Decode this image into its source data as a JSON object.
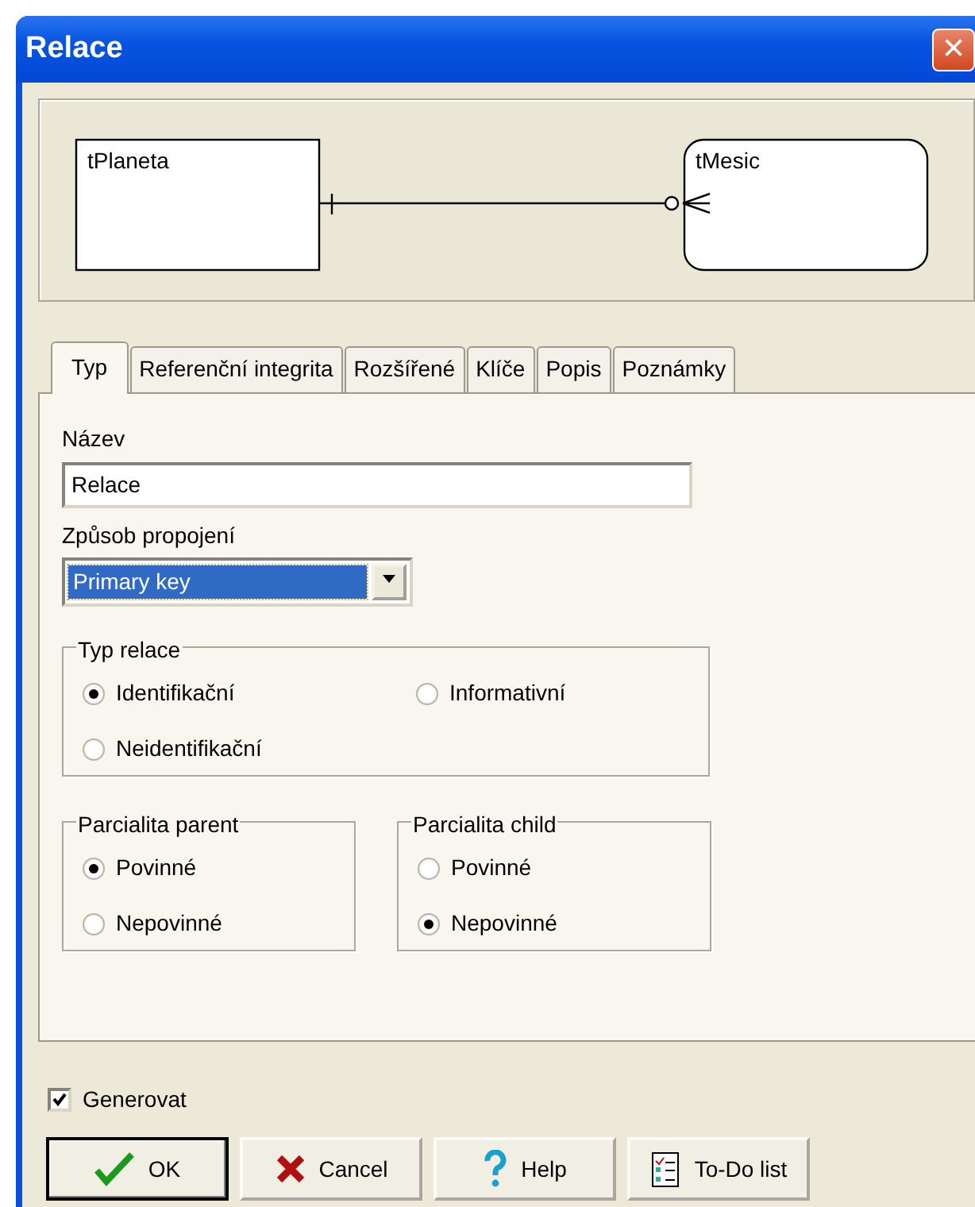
{
  "window": {
    "title": "Relace",
    "close": "×"
  },
  "diagram": {
    "entities": [
      {
        "name": "tPlaneta",
        "kind": "strong"
      },
      {
        "name": "tMesic",
        "kind": "weak"
      }
    ]
  },
  "tabs": [
    {
      "label": "Typ",
      "selected": true
    },
    {
      "label": "Referenční integrita",
      "selected": false
    },
    {
      "label": "Rozšířené",
      "selected": false
    },
    {
      "label": "Klíče",
      "selected": false
    },
    {
      "label": "Popis",
      "selected": false
    },
    {
      "label": "Poznámky",
      "selected": false
    }
  ],
  "name_field": {
    "label": "Název",
    "value": "Relace"
  },
  "join_field": {
    "label": "Způsob propojení",
    "value": "Primary key"
  },
  "groups": [
    {
      "title": "Typ relace",
      "kind": "wide",
      "options": [
        {
          "label": "Identifikační",
          "selected": true
        },
        {
          "label": "Informativní",
          "selected": false
        },
        {
          "label": "Neidentifikační",
          "selected": false
        }
      ]
    },
    {
      "title": "Parcialita parent",
      "kind": "narrow",
      "options": [
        {
          "label": "Povinné",
          "selected": true
        },
        {
          "label": "Nepovinné",
          "selected": false
        }
      ]
    },
    {
      "title": "Parcialita child",
      "kind": "narrow",
      "options": [
        {
          "label": "Povinné",
          "selected": false
        },
        {
          "label": "Nepovinné",
          "selected": true
        }
      ]
    }
  ],
  "generate": {
    "label": "Generovat",
    "checked": true
  },
  "buttons": [
    {
      "label": "OK",
      "kind": "ok"
    },
    {
      "label": "Cancel",
      "kind": "cancel"
    },
    {
      "label": "Help",
      "kind": "help"
    },
    {
      "label": "To-Do list",
      "kind": "todo"
    }
  ]
}
